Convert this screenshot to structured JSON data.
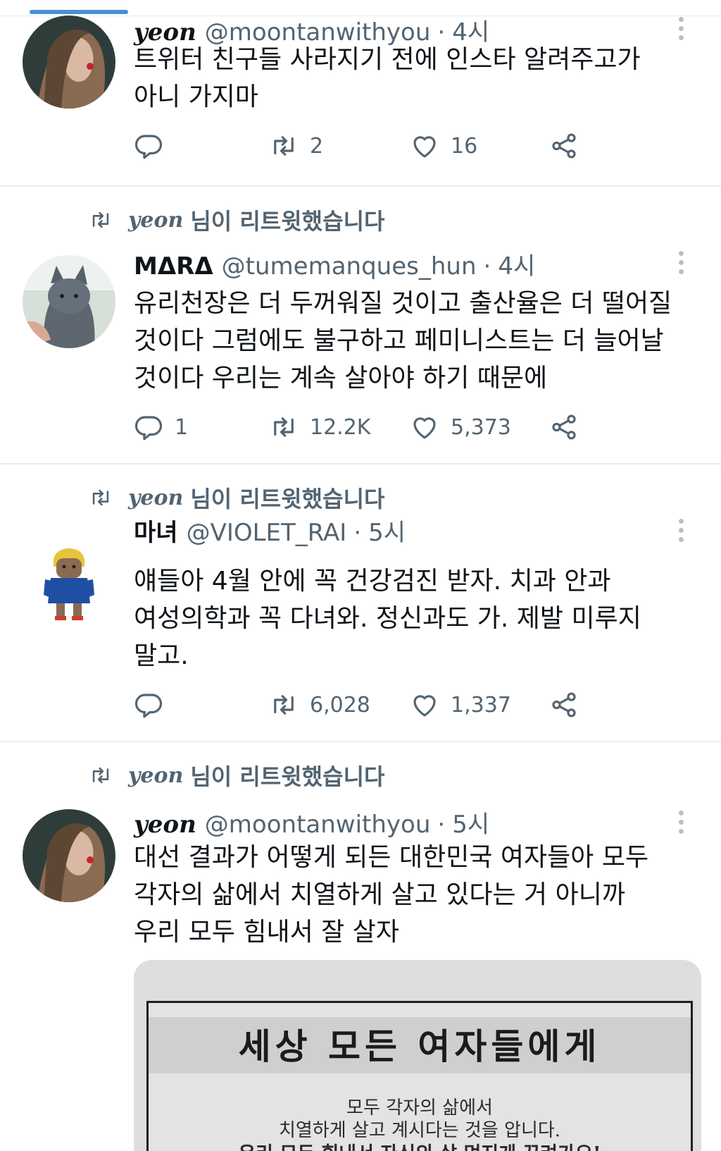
{
  "tweets": [
    {
      "name": "yeon",
      "handle": "@moontanwithyou",
      "time": "4시",
      "lines": [
        "트위터 친구들 사라지기 전에 인스타 알려주고가",
        "아니 가지마"
      ],
      "replies": "",
      "retweets": "2",
      "likes": "16"
    },
    {
      "retweeted_by": "yeon",
      "retweet_label": "님이 리트윗했습니다",
      "name": "MΔRΔ",
      "handle": "@tumemanques_hun",
      "time": "4시",
      "lines": [
        "유리천장은 더 두꺼워질 것이고 출산율은 더 떨어질",
        "것이다 그럼에도 불구하고 페미니스트는 더 늘어날",
        "것이다 우리는 계속 살아야 하기 때문에"
      ],
      "replies": "1",
      "retweets": "12.2K",
      "likes": "5,373"
    },
    {
      "retweeted_by": "yeon",
      "retweet_label": "님이 리트윗했습니다",
      "name": "마녀",
      "handle": "@VIOLET_RAI",
      "time": "5시",
      "lines": [
        "얘들아 4월 안에 꼭 건강검진 받자. 치과 안과",
        "여성의학과 꼭 다녀와. 정신과도 가. 제발 미루지",
        "말고."
      ],
      "replies": "",
      "retweets": "6,028",
      "likes": "1,337"
    },
    {
      "retweeted_by": "yeon",
      "retweet_label": "님이 리트윗했습니다",
      "name": "yeon",
      "handle": "@moontanwithyou",
      "time": "5시",
      "lines": [
        "대선 결과가 어떻게 되든 대한민국 여자들아 모두",
        "각자의 삶에서 치열하게 살고 있다는 거 아니까",
        "우리 모두 힘내서 잘 살자"
      ],
      "image": {
        "title": "세상 모든 여자들에게",
        "lines": [
          "모두 각자의 삶에서",
          "치열하게 살고 계시다는 것을 압니다.",
          "우리 모두 힘내서 자신의 삶 멋지게 꾸려가요!"
        ]
      }
    }
  ],
  "colors": {
    "text": "#0f1419",
    "muted": "#536471",
    "divider": "#e9edef",
    "accent": "#4a8fd6"
  }
}
